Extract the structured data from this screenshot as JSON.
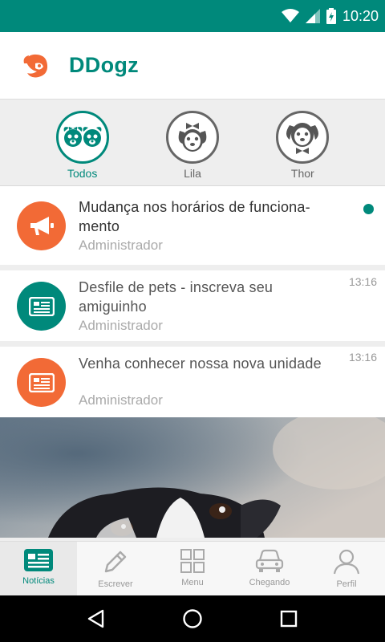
{
  "status_bar": {
    "time": "10:20",
    "icons": [
      "wifi-icon",
      "signal-icon",
      "battery-charging-icon"
    ]
  },
  "app": {
    "title": "DDogz",
    "logo": "ddogz-logo-icon",
    "accent_color": "#00897b",
    "orange_color": "#f26a36"
  },
  "profiles": [
    {
      "label": "Todos",
      "icon": "two-dogs-icon",
      "active": true
    },
    {
      "label": "Lila",
      "icon": "dog-with-bow-icon",
      "active": false
    },
    {
      "label": "Thor",
      "icon": "dog-with-bowtie-icon",
      "active": false
    }
  ],
  "news": [
    {
      "title": "Mudança nos horários de funciona-mento",
      "author": "Administrador",
      "time": "",
      "unread": true,
      "icon": "megaphone-icon",
      "color": "#f26a36"
    },
    {
      "title": "Desfile de pets - inscreva seu amiguinho",
      "author": "Administrador",
      "time": "13:16",
      "unread": false,
      "icon": "newspaper-icon",
      "color": "#00897b"
    },
    {
      "title": "Venha conhecer nossa nova unidade",
      "author": "Administrador",
      "time": "13:16",
      "unread": false,
      "icon": "newspaper-icon",
      "color": "#f26a36"
    }
  ],
  "bottom_nav": [
    {
      "label": "Notícias",
      "icon": "news-icon",
      "active": true
    },
    {
      "label": "Escrever",
      "icon": "pencil-icon",
      "active": false
    },
    {
      "label": "Menu",
      "icon": "grid-icon",
      "active": false
    },
    {
      "label": "Chegando",
      "icon": "car-icon",
      "active": false
    },
    {
      "label": "Perfil",
      "icon": "person-icon",
      "active": false
    }
  ],
  "system_nav": [
    "back-icon",
    "home-icon",
    "recents-icon"
  ]
}
